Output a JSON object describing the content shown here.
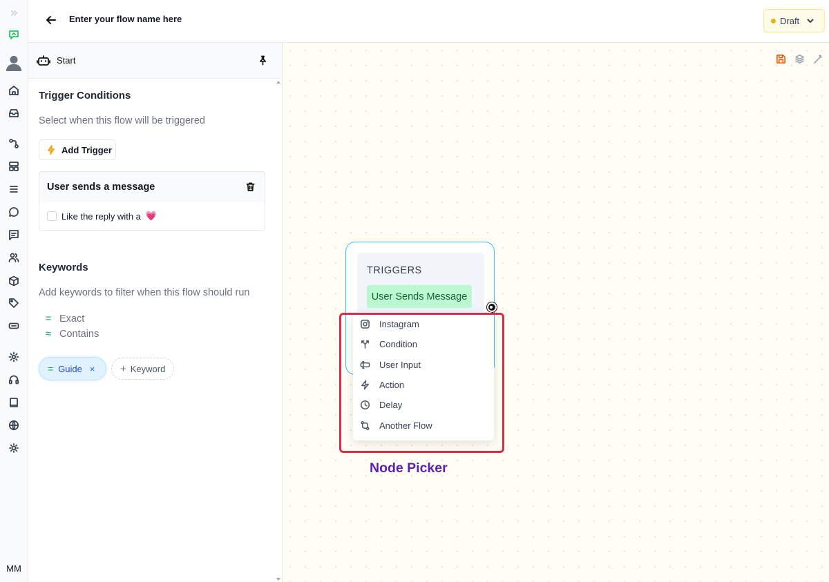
{
  "rail": {
    "user_initials": "MM",
    "icons": [
      "collapse-icon",
      "flow-icon",
      "avatar",
      "home-icon",
      "inbox-icon",
      "automation-icon",
      "templates-icon",
      "list-icon",
      "chat-icon",
      "comments-icon",
      "contacts-icon",
      "package-icon",
      "tag-icon",
      "integration-icon",
      "settings-icon",
      "support-icon",
      "docs-icon",
      "language-icon",
      "theme-icon"
    ]
  },
  "header": {
    "flow_name_placeholder": "Enter your flow name here",
    "status_label": "Draft",
    "status_color": "#eab308"
  },
  "panel": {
    "title": "Start",
    "trigger_section": {
      "title": "Trigger Conditions",
      "subtitle": "Select when this flow will be triggered",
      "add_button": "Add Trigger",
      "card": {
        "title": "User sends a message",
        "option_label": "Like the reply with a",
        "option_emoji": "💗",
        "option_checked": false
      }
    },
    "keywords_section": {
      "title": "Keywords",
      "subtitle": "Add keywords to filter when this flow should run",
      "match_types": [
        {
          "symbol": "=",
          "label": "Exact"
        },
        {
          "symbol": "≈",
          "label": "Contains"
        }
      ],
      "keywords": [
        {
          "symbol": "=",
          "label": "Guide",
          "remove": "×"
        }
      ],
      "add_keyword": {
        "symbol": "+",
        "label": "Keyword"
      }
    }
  },
  "canvas": {
    "tools": [
      "save-icon",
      "layers-icon",
      "magic-wand-icon"
    ],
    "trigger_node": {
      "heading": "TRIGGERS",
      "trigger": "User Sends Message"
    },
    "node_picker": {
      "items": [
        {
          "label": "Instagram",
          "icon": "instagram-icon"
        },
        {
          "label": "Condition",
          "icon": "condition-icon"
        },
        {
          "label": "User Input",
          "icon": "user-input-icon"
        },
        {
          "label": "Action",
          "icon": "action-icon"
        },
        {
          "label": "Delay",
          "icon": "delay-icon"
        },
        {
          "label": "Another Flow",
          "icon": "another-flow-icon"
        }
      ],
      "annotation": "Node Picker",
      "highlight_color": "#dc2b48",
      "annotation_color": "#5b21b6"
    }
  }
}
